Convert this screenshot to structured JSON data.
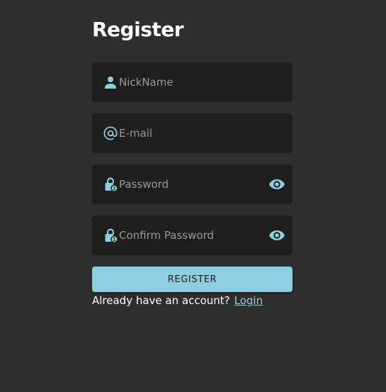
{
  "form": {
    "title": "Register",
    "fields": [
      {
        "placeholder": "NickName",
        "value": "",
        "icon": "person-icon"
      },
      {
        "placeholder": "E-mail",
        "value": "",
        "icon": "at-sign-icon"
      },
      {
        "placeholder": "Password",
        "value": "",
        "icon": "lock-icon",
        "toggle_icon": "eye-icon"
      },
      {
        "placeholder": "Confirm Password",
        "value": "",
        "icon": "lock-icon",
        "toggle_icon": "eye-icon"
      }
    ],
    "submit_label": "REGISTER",
    "footer_text": "Already have an account?",
    "login_link": "Login"
  },
  "colors": {
    "background": "#2e2e2e",
    "field_background": "#1e1e1e",
    "accent": "#8ccfe0",
    "placeholder": "#9a9a9a",
    "text": "#ffffff"
  }
}
